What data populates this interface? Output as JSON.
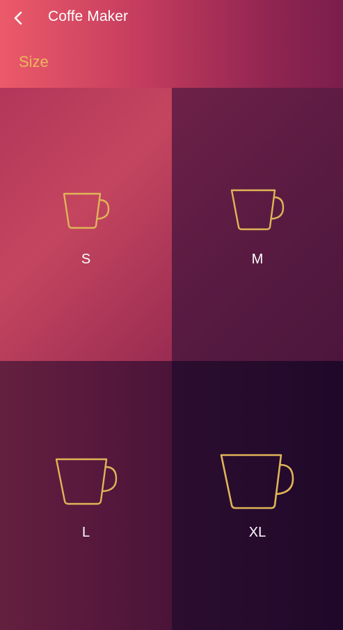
{
  "header": {
    "back_icon": "chevron-left-icon",
    "title": "Coffe Maker",
    "section_label": "Size"
  },
  "colors": {
    "accent": "#ecb65c",
    "cup_stroke": "#e0b558"
  },
  "sizes": [
    {
      "label": "S",
      "icon": "small-cup-icon"
    },
    {
      "label": "M",
      "icon": "medium-cup-icon"
    },
    {
      "label": "L",
      "icon": "large-cup-icon"
    },
    {
      "label": "XL",
      "icon": "extra-large-cup-icon"
    }
  ]
}
